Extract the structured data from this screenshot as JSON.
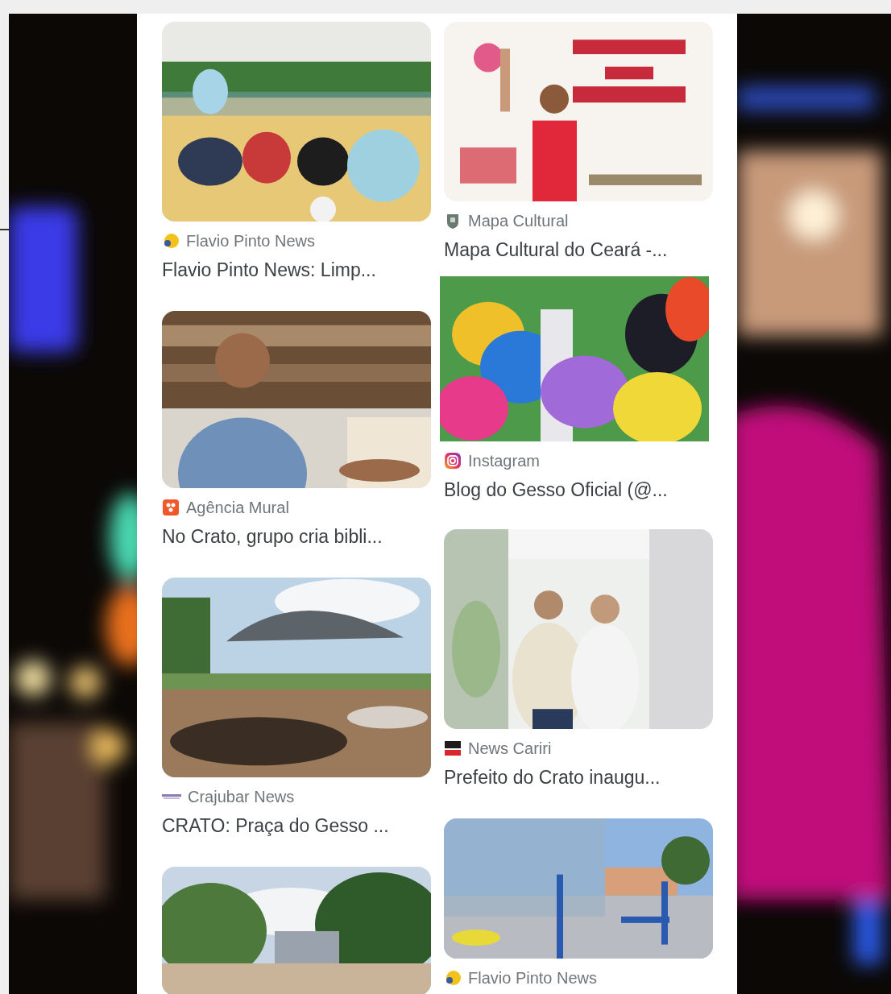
{
  "results": {
    "columns": [
      {
        "cards": [
          {
            "kind": "picture",
            "source": {
              "name": "Flavio Pinto News",
              "kind": "mascot"
            },
            "title": "Flavio Pinto News: Limp..."
          },
          {
            "kind": "picture",
            "source": {
              "name": "Agência Mural",
              "kind": "grid"
            },
            "title": "No Crato, grupo cria bibli..."
          },
          {
            "kind": "picture",
            "source": {
              "name": "Crajubar News",
              "kind": "wordmark"
            },
            "title": "CRATO: Praça do Gesso ..."
          },
          {
            "kind": "picture"
          }
        ]
      },
      {
        "cards": [
          {
            "kind": "picture",
            "source": {
              "name": "Mapa Cultural",
              "kind": "shield"
            },
            "title": "Mapa Cultural do Ceará -..."
          },
          {
            "kind": "picture",
            "source": {
              "name": "Instagram",
              "kind": "camera"
            },
            "title": "Blog do Gesso Oficial (@..."
          },
          {
            "kind": "picture",
            "source": {
              "name": "News Cariri",
              "kind": "newspaper"
            },
            "title": "Prefeito do Crato inaugu..."
          },
          {
            "kind": "picture",
            "source": {
              "name": "Flavio Pinto News",
              "kind": "mascot"
            }
          }
        ]
      }
    ]
  }
}
